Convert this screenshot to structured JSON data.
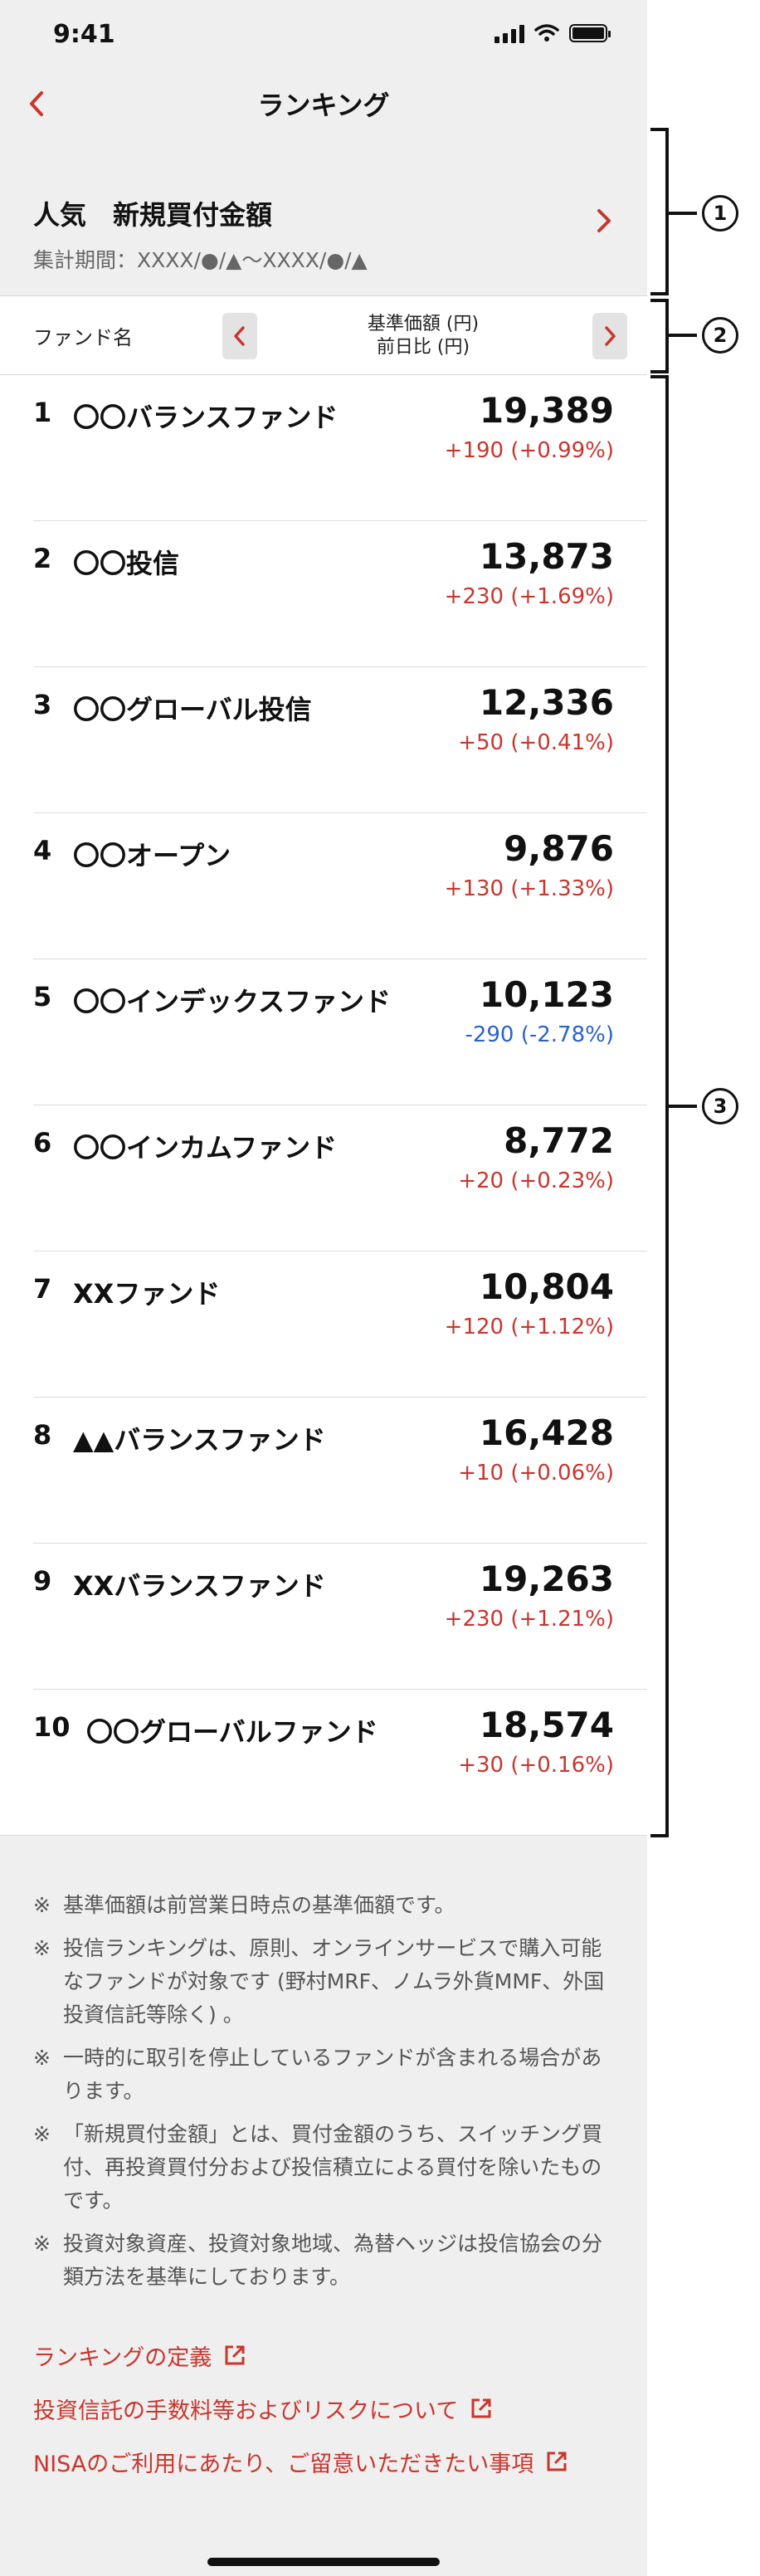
{
  "status": {
    "time": "9:41"
  },
  "nav": {
    "title": "ランキング"
  },
  "header": {
    "title": "人気　新規買付金額",
    "period": "集計期間：XXXX/●/▲〜XXXX/●/▲"
  },
  "table_header": {
    "name_label": "ファンド名",
    "col_line1": "基準価額 (円)",
    "col_line2": "前日比 (円)"
  },
  "funds": [
    {
      "rank": "1",
      "name": "〇〇バランスファンド",
      "price": "19,389",
      "change": "+190 (+0.99%)"
    },
    {
      "rank": "2",
      "name": "〇〇投信",
      "price": "13,873",
      "change": "+230 (+1.69%)"
    },
    {
      "rank": "3",
      "name": "〇〇グローバル投信",
      "price": "12,336",
      "change": "+50 (+0.41%)"
    },
    {
      "rank": "4",
      "name": "〇〇オープン",
      "price": "9,876",
      "change": "+130 (+1.33%)"
    },
    {
      "rank": "5",
      "name": "〇〇インデックスファンド",
      "price": "10,123",
      "change": "-290 (-2.78%)"
    },
    {
      "rank": "6",
      "name": "〇〇インカムファンド",
      "price": "8,772",
      "change": "+20 (+0.23%)"
    },
    {
      "rank": "7",
      "name": "XXファンド",
      "price": "10,804",
      "change": "+120 (+1.12%)"
    },
    {
      "rank": "8",
      "name": "▲▲バランスファンド",
      "price": "16,428",
      "change": "+10 (+0.06%)"
    },
    {
      "rank": "9",
      "name": "XXバランスファンド",
      "price": "19,263",
      "change": "+230 (+1.21%)"
    },
    {
      "rank": "10",
      "name": "〇〇グローバルファンド",
      "price": "18,574",
      "change": "+30 (+0.16%)"
    }
  ],
  "notes": [
    "基準価額は前営業日時点の基準価額です。",
    "投信ランキングは、原則、オンラインサービスで購入可能なファンドが対象です (野村MRF、ノムラ外貨MMF、外国投資信託等除く) 。",
    "一時的に取引を停止しているファンドが含まれる場合があります。",
    "「新規買付金額」とは、買付金額のうち、スイッチング買付、再投資買付分および投信積立による買付を除いたものです。",
    "投資対象資産、投資対象地域、為替ヘッジは投信協会の分類方法を基準にしております。"
  ],
  "note_mark": "※",
  "links": [
    "ランキングの定義",
    "投資信託の手数料等およびリスクについて",
    "NISAのご利用にあたり、ご留意いただきたい事項"
  ],
  "annotations": [
    "1",
    "2",
    "3"
  ],
  "colors": {
    "accent": "#c8362e",
    "negative": "#2a62c9",
    "background": "#efefef"
  }
}
